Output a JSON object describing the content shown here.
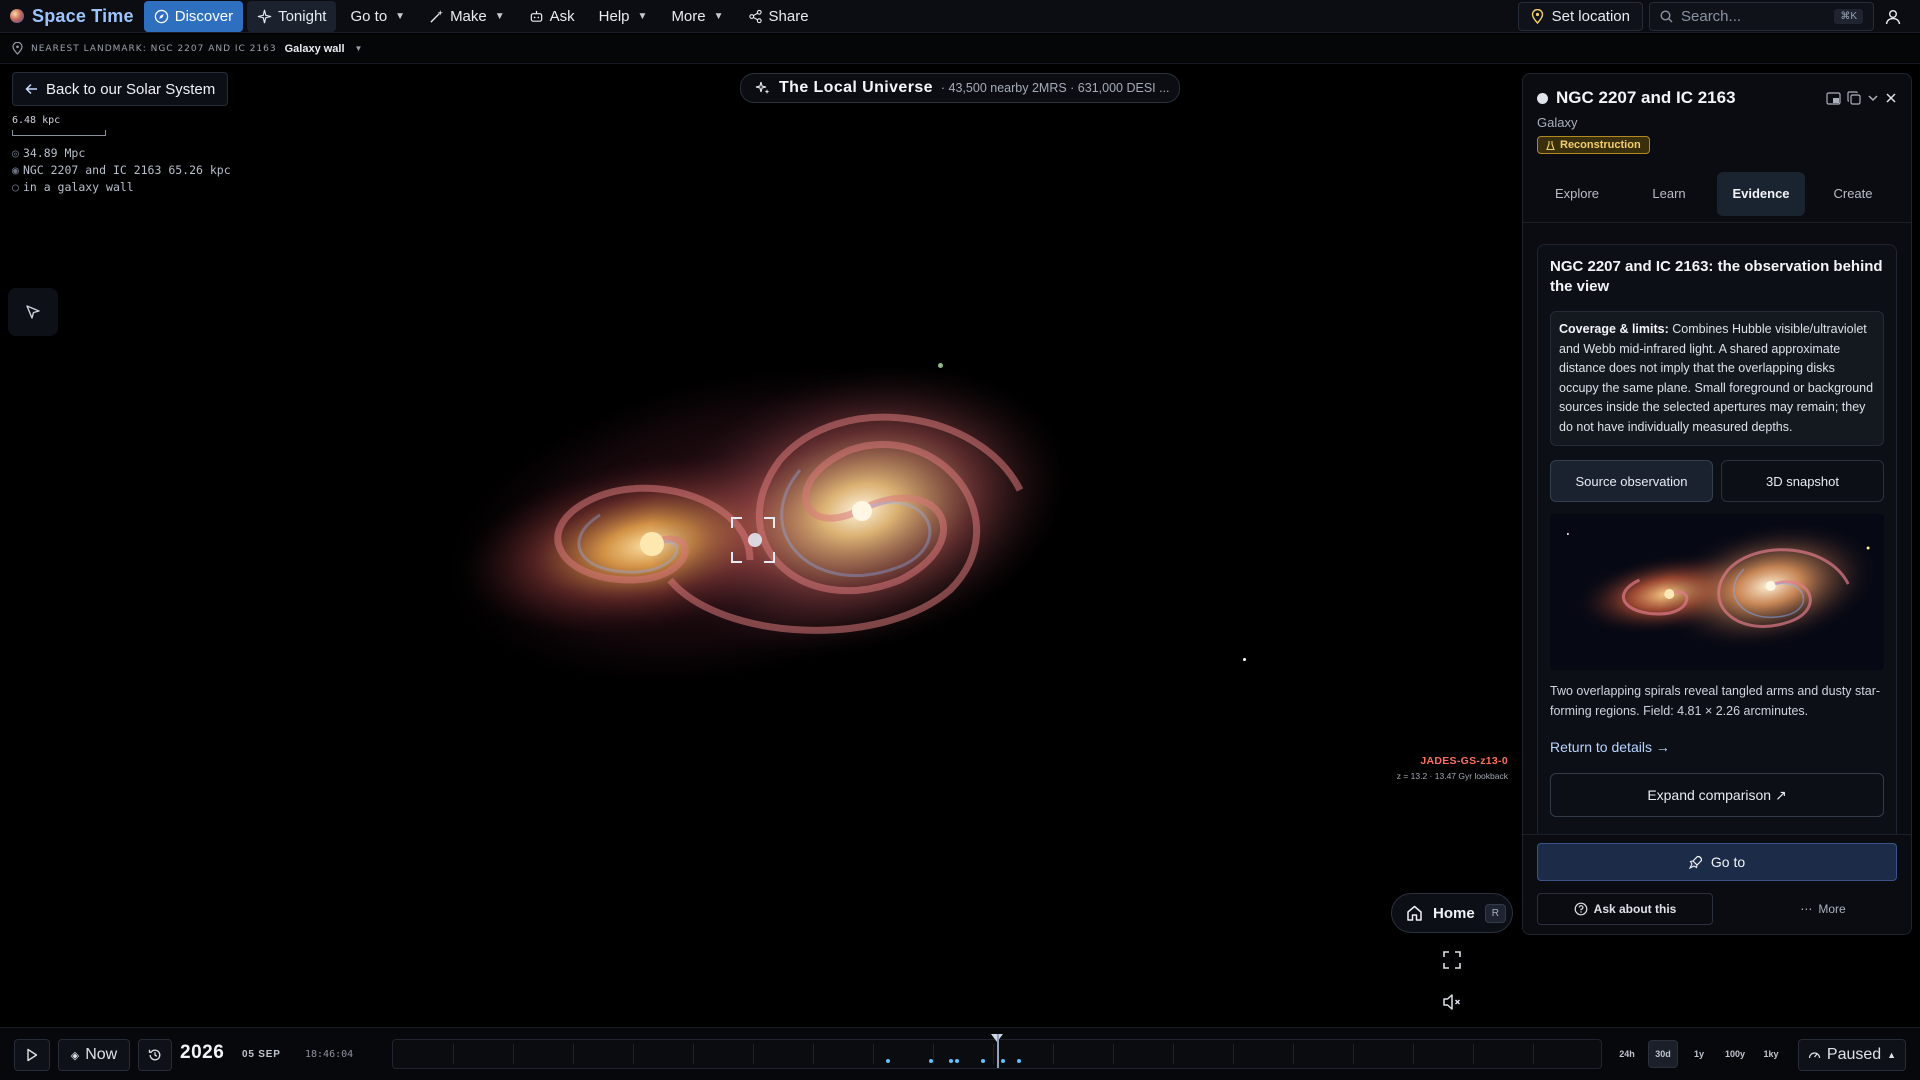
{
  "app": {
    "name": "Space Time"
  },
  "nav": {
    "discover": "Discover",
    "tonight": "Tonight",
    "goto": "Go to",
    "make": "Make",
    "ask": "Ask",
    "help": "Help",
    "more": "More",
    "share": "Share"
  },
  "top_right": {
    "set_location": "Set location",
    "search_placeholder": "Search...",
    "search_kbd": "⌘K"
  },
  "landmark": {
    "label": "NEAREST LANDMARK: NGC 2207 AND IC 2163",
    "value": "Galaxy wall"
  },
  "back_button": "Back to our Solar System",
  "scale": {
    "label": "6.48 kpc",
    "lines": [
      "34.89 Mpc",
      "NGC 2207 and IC 2163 65.26 kpc",
      "in a galaxy wall"
    ]
  },
  "view_title": {
    "title": "The Local Universe",
    "subtitle": "· 43,500 nearby 2MRS · 631,000 DESI ..."
  },
  "marker": {
    "name": "JADES-GS-z13-0",
    "meta": "z = 13.2 · 13.47 Gyr lookback"
  },
  "home": {
    "label": "Home",
    "kbd": "R"
  },
  "panel": {
    "title": "NGC 2207 and IC 2163",
    "subtitle": "Galaxy",
    "badge": "Reconstruction",
    "tabs": [
      "Explore",
      "Learn",
      "Evidence",
      "Create"
    ],
    "active_tab": "Evidence",
    "evidence": {
      "title": "NGC 2207 and IC 2163: the observation behind the view",
      "coverage_label": "Coverage & limits:",
      "coverage_text": " Combines Hubble visible/ultraviolet and Webb mid-infrared light. A shared approximate distance does not imply that the overlapping disks occupy the same plane. Small foreground or background sources inside the selected apertures may remain; they do not have individually measured depths.",
      "source_button": "Source observation",
      "snapshot_button": "3D snapshot",
      "caption": "Two overlapping spirals reveal tangled arms and dusty star-forming regions. Field: 4.81 × 2.26 arcminutes.",
      "return_link": "Return to details →",
      "expand_button": "Expand comparison ↗"
    },
    "footer": {
      "goto": "Go to",
      "ask": "Ask about this",
      "more": "More"
    }
  },
  "timebar": {
    "now": "Now",
    "year": "2026",
    "date": "05 SEP",
    "clock": "18:46:04",
    "ranges": [
      "24h",
      "30d",
      "1y",
      "100y",
      "1ky"
    ],
    "active_range": "30d",
    "status": "Paused"
  },
  "colors": {
    "accent": "#2f6fbf",
    "badge": "#f2cf6b",
    "marker": "#ff6f5e"
  }
}
